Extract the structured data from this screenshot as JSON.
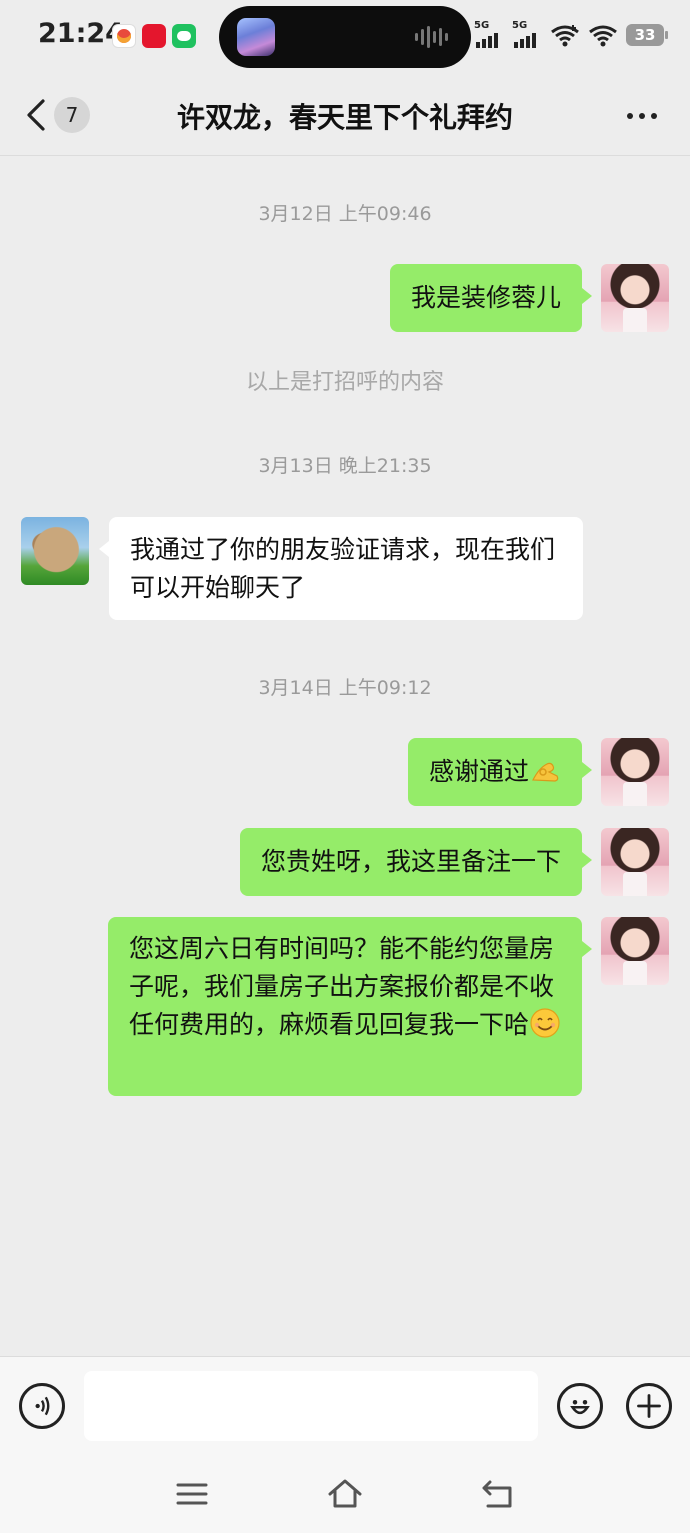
{
  "status_bar": {
    "time": "21:24",
    "network_1": "5G",
    "network_2": "5G",
    "battery": "33",
    "app_icons": [
      "app-icon",
      "xiaohongshu-icon",
      "wechat-icon"
    ]
  },
  "header": {
    "unread_count": "7",
    "title": "许双龙，春天里下个礼拜约",
    "icons": {
      "back": "chevron-left-icon",
      "more": "more-dots-icon"
    }
  },
  "chat": {
    "timestamps": [
      "3月12日 上午09:46",
      "3月13日 晚上21:35",
      "3月14日 上午09:12"
    ],
    "greeting_note": "以上是打招呼的内容",
    "messages": [
      {
        "sender": "me",
        "text": "我是装修蓉儿"
      },
      {
        "sender": "other",
        "text": "我通过了你的朋友验证请求，现在我们可以开始聊天了"
      },
      {
        "sender": "me",
        "text": "感谢通过",
        "emoji": "ok-hand-emoji"
      },
      {
        "sender": "me",
        "text": "您贵姓呀，我这里备注一下"
      },
      {
        "sender": "me",
        "text": "您这周六日有时间吗？能不能约您量房子呢，我们量房子出方案报价都是不收任何费用的，麻烦看见回复我一下哈",
        "emoji": "smile-emoji"
      }
    ]
  },
  "input_bar": {
    "value": "",
    "icons": {
      "voice": "voice-icon",
      "emoji": "emoji-face-icon",
      "plus": "plus-icon"
    }
  },
  "nav_bar": {
    "icons": [
      "menu-icon",
      "home-icon",
      "back-icon"
    ]
  },
  "colors": {
    "background": "#ededed",
    "outgoing_bubble": "#95ec69",
    "incoming_bubble": "#ffffff",
    "timestamp_text": "#9a9a9a"
  }
}
